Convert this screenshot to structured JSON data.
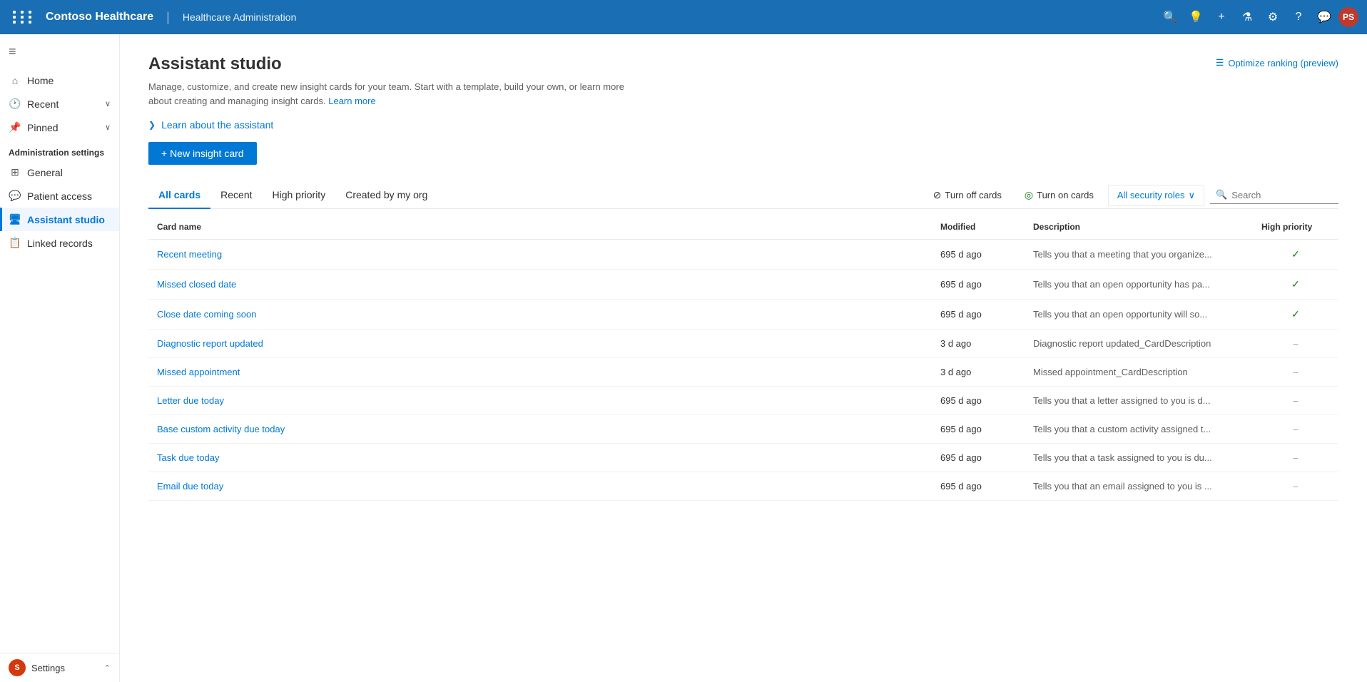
{
  "app": {
    "title": "Contoso Healthcare",
    "subtitle": "Healthcare Administration",
    "avatar": "PS"
  },
  "sidebar": {
    "hamburger_icon": "≡",
    "items": [
      {
        "id": "home",
        "label": "Home",
        "icon": "⌂",
        "active": false
      },
      {
        "id": "recent",
        "label": "Recent",
        "icon": "⏱",
        "chevron": "∨",
        "active": false
      },
      {
        "id": "pinned",
        "label": "Pinned",
        "icon": "📌",
        "chevron": "∨",
        "active": false
      }
    ],
    "admin_label": "Administration settings",
    "admin_items": [
      {
        "id": "general",
        "label": "General",
        "icon": "⊞",
        "active": false
      },
      {
        "id": "patient-access",
        "label": "Patient access",
        "icon": "💬",
        "active": false
      },
      {
        "id": "assistant-studio",
        "label": "Assistant studio",
        "icon": "🖥",
        "active": true
      },
      {
        "id": "linked-records",
        "label": "Linked records",
        "icon": "📋",
        "active": false
      }
    ],
    "bottom": {
      "label": "Settings",
      "avatar": "S",
      "chevron": "⌃"
    }
  },
  "page": {
    "title": "Assistant studio",
    "description": "Manage, customize, and create new insight cards for your team. Start with a template, build your own, or learn more about creating and managing insight cards.",
    "learn_more_link": "Learn more",
    "optimize_label": "Optimize ranking (preview)",
    "learn_section_label": "Learn about the assistant"
  },
  "new_card_button": "+ New insight card",
  "tabs": [
    {
      "id": "all-cards",
      "label": "All cards",
      "active": true
    },
    {
      "id": "recent",
      "label": "Recent",
      "active": false
    },
    {
      "id": "high-priority",
      "label": "High priority",
      "active": false
    },
    {
      "id": "created-by-my-org",
      "label": "Created by my org",
      "active": false
    }
  ],
  "toolbar": {
    "turn_off_label": "Turn off cards",
    "turn_off_icon": "⊘",
    "turn_on_label": "Turn on cards",
    "turn_on_icon": "◎",
    "security_roles_label": "All security roles",
    "security_roles_chevron": "∨",
    "search_placeholder": "Search",
    "search_icon": "🔍"
  },
  "table": {
    "columns": [
      {
        "id": "card-name",
        "label": "Card name"
      },
      {
        "id": "modified",
        "label": "Modified"
      },
      {
        "id": "description",
        "label": "Description"
      },
      {
        "id": "high-priority",
        "label": "High priority"
      }
    ],
    "rows": [
      {
        "name": "Recent meeting",
        "modified": "695 d ago",
        "description": "Tells you that a meeting that you organize...",
        "priority": "check"
      },
      {
        "name": "Missed closed date",
        "modified": "695 d ago",
        "description": "Tells you that an open opportunity has pa...",
        "priority": "check"
      },
      {
        "name": "Close date coming soon",
        "modified": "695 d ago",
        "description": "Tells you that an open opportunity will so...",
        "priority": "check"
      },
      {
        "name": "Diagnostic report updated",
        "modified": "3 d ago",
        "description": "Diagnostic report updated_CardDescription",
        "priority": "dash"
      },
      {
        "name": "Missed appointment",
        "modified": "3 d ago",
        "description": "Missed appointment_CardDescription",
        "priority": "dash"
      },
      {
        "name": "Letter due today",
        "modified": "695 d ago",
        "description": "Tells you that a letter assigned to you is d...",
        "priority": "dash"
      },
      {
        "name": "Base custom activity due today",
        "modified": "695 d ago",
        "description": "Tells you that a custom activity assigned t...",
        "priority": "dash"
      },
      {
        "name": "Task due today",
        "modified": "695 d ago",
        "description": "Tells you that a task assigned to you is du...",
        "priority": "dash"
      },
      {
        "name": "Email due today",
        "modified": "695 d ago",
        "description": "Tells you that an email assigned to you is ...",
        "priority": "dash"
      }
    ]
  }
}
